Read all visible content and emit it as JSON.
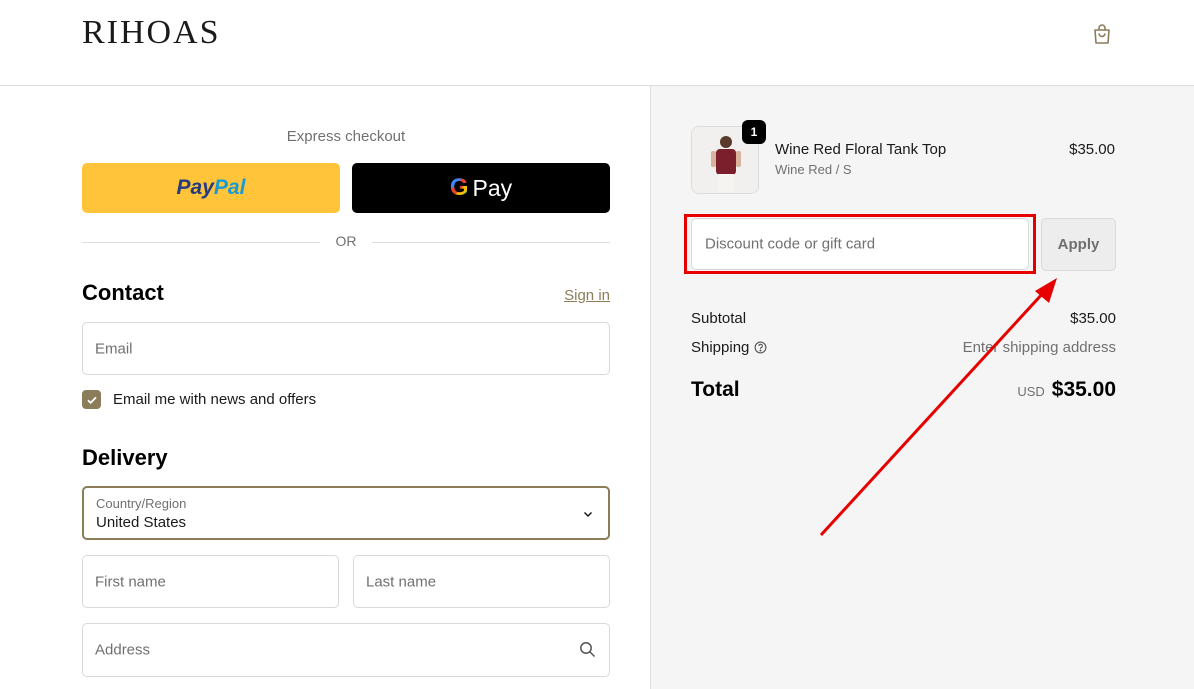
{
  "header": {
    "logo": "RIHOAS"
  },
  "express": {
    "title": "Express checkout",
    "paypal_part1": "Pay",
    "paypal_part2": "Pal",
    "gpay_g": "G",
    "gpay_label": "Pay",
    "or_label": "OR"
  },
  "contact": {
    "title": "Contact",
    "sign_in": "Sign in",
    "email_placeholder": "Email",
    "newsletter_label": "Email me with news and offers",
    "newsletter_checked": true
  },
  "delivery": {
    "title": "Delivery",
    "country_label": "Country/Region",
    "country_value": "United States",
    "first_name_placeholder": "First name",
    "last_name_placeholder": "Last name",
    "address_placeholder": "Address"
  },
  "order": {
    "item": {
      "name": "Wine Red Floral Tank Top",
      "variant": "Wine Red / S",
      "price": "$35.00",
      "quantity": "1"
    },
    "discount_placeholder": "Discount code or gift card",
    "apply_label": "Apply",
    "subtotal_label": "Subtotal",
    "subtotal_value": "$35.00",
    "shipping_label": "Shipping",
    "shipping_value": "Enter shipping address",
    "total_label": "Total",
    "currency": "USD",
    "total_value": "$35.00"
  },
  "colors": {
    "accent": "#8b7d5a",
    "paypal_yellow": "#ffc439",
    "annotation_red": "#e60000",
    "summary_bg": "#f5f5f5"
  },
  "icons": {
    "cart": "shopping-bag-icon",
    "chevron": "chevron-down-icon",
    "search": "search-icon",
    "help": "question-circle-icon",
    "check": "checkmark-icon"
  }
}
